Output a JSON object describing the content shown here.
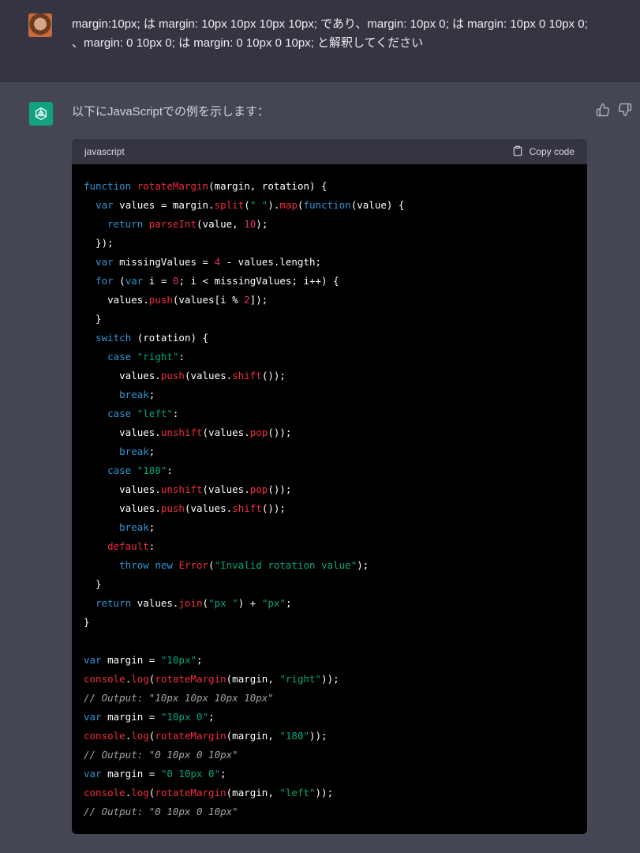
{
  "user_message": {
    "text": "margin:10px; は margin: 10px 10px 10px 10px; であり、margin: 10px 0; は margin: 10px 0 10px 0; 、margin: 0 10px 0; は margin: 0 10px 0 10px; と解釈してください",
    "avatar_icon": "user-avatar"
  },
  "assistant_message": {
    "intro": "以下にJavaScriptでの例を示します：",
    "logo_icon": "openai-logo-icon",
    "code_block": {
      "language": "javascript",
      "copy_label": "Copy code",
      "lines": [
        [
          [
            "kw",
            "function"
          ],
          [
            "pl",
            " "
          ],
          [
            "fn",
            "rotateMargin"
          ],
          [
            "pl",
            "(margin, rotation) {"
          ]
        ],
        [
          [
            "pl",
            "  "
          ],
          [
            "kw",
            "var"
          ],
          [
            "pl",
            " values = margin."
          ],
          [
            "fn",
            "split"
          ],
          [
            "pl",
            "("
          ],
          [
            "str",
            "\" \""
          ],
          [
            "pl",
            ")."
          ],
          [
            "fn",
            "map"
          ],
          [
            "pl",
            "("
          ],
          [
            "kw",
            "function"
          ],
          [
            "pl",
            "(value) {"
          ]
        ],
        [
          [
            "pl",
            "    "
          ],
          [
            "kw",
            "return"
          ],
          [
            "pl",
            " "
          ],
          [
            "fn",
            "parseInt"
          ],
          [
            "pl",
            "(value, "
          ],
          [
            "num",
            "10"
          ],
          [
            "pl",
            ");"
          ]
        ],
        [
          [
            "pl",
            "  });"
          ]
        ],
        [
          [
            "pl",
            "  "
          ],
          [
            "kw",
            "var"
          ],
          [
            "pl",
            " missingValues = "
          ],
          [
            "num",
            "4"
          ],
          [
            "pl",
            " - values.length;"
          ]
        ],
        [
          [
            "pl",
            "  "
          ],
          [
            "kw",
            "for"
          ],
          [
            "pl",
            " ("
          ],
          [
            "kw",
            "var"
          ],
          [
            "pl",
            " i = "
          ],
          [
            "num",
            "0"
          ],
          [
            "pl",
            "; i < missingValues; i++) {"
          ]
        ],
        [
          [
            "pl",
            "    values."
          ],
          [
            "fn",
            "push"
          ],
          [
            "pl",
            "(values[i % "
          ],
          [
            "num",
            "2"
          ],
          [
            "pl",
            "]);"
          ]
        ],
        [
          [
            "pl",
            "  }"
          ]
        ],
        [
          [
            "pl",
            "  "
          ],
          [
            "kw",
            "switch"
          ],
          [
            "pl",
            " (rotation) {"
          ]
        ],
        [
          [
            "pl",
            "    "
          ],
          [
            "kw",
            "case"
          ],
          [
            "pl",
            " "
          ],
          [
            "str",
            "\"right\""
          ],
          [
            "pl",
            ":"
          ]
        ],
        [
          [
            "pl",
            "      values."
          ],
          [
            "fn",
            "push"
          ],
          [
            "pl",
            "(values."
          ],
          [
            "fn",
            "shift"
          ],
          [
            "pl",
            "());"
          ]
        ],
        [
          [
            "pl",
            "      "
          ],
          [
            "kw",
            "break"
          ],
          [
            "pl",
            ";"
          ]
        ],
        [
          [
            "pl",
            "    "
          ],
          [
            "kw",
            "case"
          ],
          [
            "pl",
            " "
          ],
          [
            "str",
            "\"left\""
          ],
          [
            "pl",
            ":"
          ]
        ],
        [
          [
            "pl",
            "      values."
          ],
          [
            "fn",
            "unshift"
          ],
          [
            "pl",
            "(values."
          ],
          [
            "fn",
            "pop"
          ],
          [
            "pl",
            "());"
          ]
        ],
        [
          [
            "pl",
            "      "
          ],
          [
            "kw",
            "break"
          ],
          [
            "pl",
            ";"
          ]
        ],
        [
          [
            "pl",
            "    "
          ],
          [
            "kw",
            "case"
          ],
          [
            "pl",
            " "
          ],
          [
            "str",
            "\"180\""
          ],
          [
            "pl",
            ":"
          ]
        ],
        [
          [
            "pl",
            "      values."
          ],
          [
            "fn",
            "unshift"
          ],
          [
            "pl",
            "(values."
          ],
          [
            "fn",
            "pop"
          ],
          [
            "pl",
            "());"
          ]
        ],
        [
          [
            "pl",
            "      values."
          ],
          [
            "fn",
            "push"
          ],
          [
            "pl",
            "(values."
          ],
          [
            "fn",
            "shift"
          ],
          [
            "pl",
            "());"
          ]
        ],
        [
          [
            "pl",
            "      "
          ],
          [
            "kw",
            "break"
          ],
          [
            "pl",
            ";"
          ]
        ],
        [
          [
            "pl",
            "    "
          ],
          [
            "fn",
            "default"
          ],
          [
            "pl",
            ":"
          ]
        ],
        [
          [
            "pl",
            "      "
          ],
          [
            "kw",
            "throw"
          ],
          [
            "pl",
            " "
          ],
          [
            "kw",
            "new"
          ],
          [
            "pl",
            " "
          ],
          [
            "fn",
            "Error"
          ],
          [
            "pl",
            "("
          ],
          [
            "str",
            "\"Invalid rotation value\""
          ],
          [
            "pl",
            ");"
          ]
        ],
        [
          [
            "pl",
            "  }"
          ]
        ],
        [
          [
            "pl",
            "  "
          ],
          [
            "kw",
            "return"
          ],
          [
            "pl",
            " values."
          ],
          [
            "fn",
            "join"
          ],
          [
            "pl",
            "("
          ],
          [
            "str",
            "\"px \""
          ],
          [
            "pl",
            ") + "
          ],
          [
            "str",
            "\"px\""
          ],
          [
            "pl",
            ";"
          ]
        ],
        [
          [
            "pl",
            "}"
          ]
        ],
        [],
        [
          [
            "kw",
            "var"
          ],
          [
            "pl",
            " margin = "
          ],
          [
            "str",
            "\"10px\""
          ],
          [
            "pl",
            ";"
          ]
        ],
        [
          [
            "fn",
            "console"
          ],
          [
            "pl",
            "."
          ],
          [
            "fn",
            "log"
          ],
          [
            "pl",
            "("
          ],
          [
            "fn",
            "rotateMargin"
          ],
          [
            "pl",
            "(margin, "
          ],
          [
            "str",
            "\"right\""
          ],
          [
            "pl",
            "));"
          ]
        ],
        [
          [
            "cm",
            "// Output: \"10px 10px 10px 10px\""
          ]
        ],
        [
          [
            "kw",
            "var"
          ],
          [
            "pl",
            " margin = "
          ],
          [
            "str",
            "\"10px 0\""
          ],
          [
            "pl",
            ";"
          ]
        ],
        [
          [
            "fn",
            "console"
          ],
          [
            "pl",
            "."
          ],
          [
            "fn",
            "log"
          ],
          [
            "pl",
            "("
          ],
          [
            "fn",
            "rotateMargin"
          ],
          [
            "pl",
            "(margin, "
          ],
          [
            "str",
            "\"180\""
          ],
          [
            "pl",
            "));"
          ]
        ],
        [
          [
            "cm",
            "// Output: \"0 10px 0 10px\""
          ]
        ],
        [
          [
            "kw",
            "var"
          ],
          [
            "pl",
            " margin = "
          ],
          [
            "str",
            "\"0 10px 0\""
          ],
          [
            "pl",
            ";"
          ]
        ],
        [
          [
            "fn",
            "console"
          ],
          [
            "pl",
            "."
          ],
          [
            "fn",
            "log"
          ],
          [
            "pl",
            "("
          ],
          [
            "fn",
            "rotateMargin"
          ],
          [
            "pl",
            "(margin, "
          ],
          [
            "str",
            "\"left\""
          ],
          [
            "pl",
            "));"
          ]
        ],
        [
          [
            "cm",
            "// Output: \"0 10px 0 10px\""
          ]
        ]
      ]
    },
    "feedback_icons": [
      "thumbs-up-icon",
      "thumbs-down-icon"
    ]
  },
  "colors": {
    "user_bg": "#343541",
    "assistant_bg": "#444654",
    "code_bg": "#000000",
    "keyword": "#2e95d3",
    "function": "#f22c3d",
    "string": "#00a67d",
    "number": "#df3079",
    "comment": "#a5a5a5",
    "brand": "#10a37f"
  }
}
